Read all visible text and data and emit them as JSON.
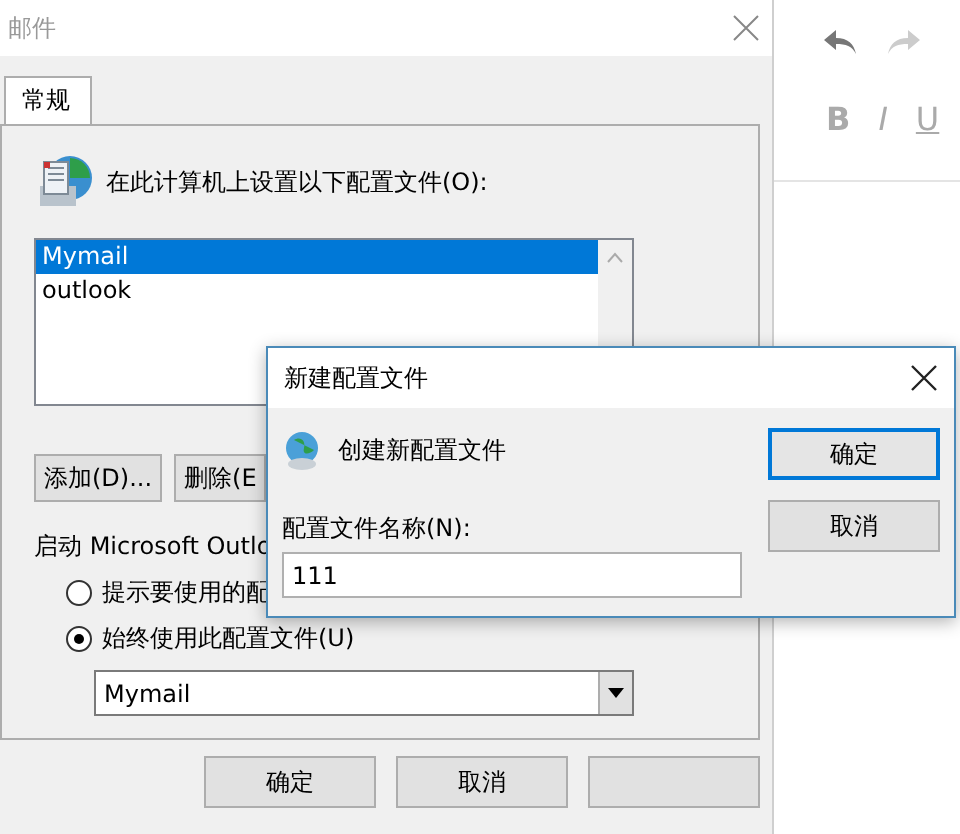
{
  "main_dialog": {
    "title": "邮件",
    "tabs": [
      {
        "label": "常规",
        "selected": true
      }
    ],
    "profiles_label": "在此计算机上设置以下配置文件(O):",
    "profiles": [
      {
        "name": "Mymail",
        "selected": true
      },
      {
        "name": "outlook",
        "selected": false
      }
    ],
    "buttons": [
      "添加(D)...",
      "删除(E"
    ],
    "startup_label": "启动 Microsoft Outlo",
    "startup_options": [
      {
        "label": "提示要使用的配",
        "selected": false
      },
      {
        "label": "始终使用此配置文件(U)",
        "selected": true
      }
    ],
    "profile_dropdown": {
      "value": "Mymail"
    },
    "footer_buttons": [
      "确定",
      "取消"
    ]
  },
  "editor_toolbar": {
    "format_buttons": [
      "B",
      "I",
      "U"
    ]
  },
  "new_profile_dialog": {
    "title": "新建配置文件",
    "heading": "创建新配置文件",
    "name_label": "配置文件名称(N):",
    "name_field": {
      "value": "111"
    },
    "buttons": [
      {
        "label": "确定",
        "default": true
      },
      {
        "label": "取消",
        "default": false
      }
    ]
  }
}
